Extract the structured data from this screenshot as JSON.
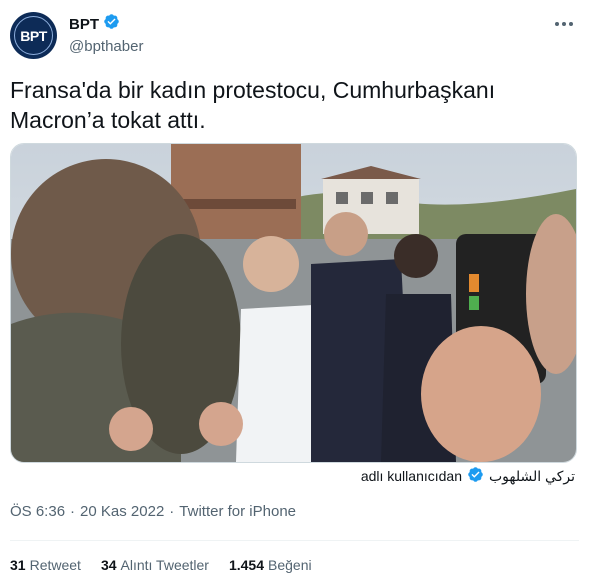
{
  "author": {
    "avatar_text": "BPT",
    "display_name": "BPT",
    "handle": "@bpthaber",
    "verified_icon": "verified-badge-icon"
  },
  "tweet": {
    "text_line1": "Fransa'da bir kadın protestocu, Cumhurbaşkanı",
    "text_line2": "Macron’a tokat attı."
  },
  "media": {
    "attribution_name": "تركي الشلهوب",
    "attribution_suffix": "adlı kullanıcıdan"
  },
  "meta": {
    "time": "ÖS 6:36",
    "date": "20 Kas 2022",
    "separator": "·",
    "source": "Twitter for iPhone"
  },
  "stats": [
    {
      "count": "31",
      "label": "Retweet"
    },
    {
      "count": "34",
      "label": "Alıntı Tweetler"
    },
    {
      "count": "1.454",
      "label": "Beğeni"
    }
  ],
  "colors": {
    "verified": "#1d9bf0",
    "secondary_text": "#536471",
    "avatar_bg": "#0d2b57"
  }
}
